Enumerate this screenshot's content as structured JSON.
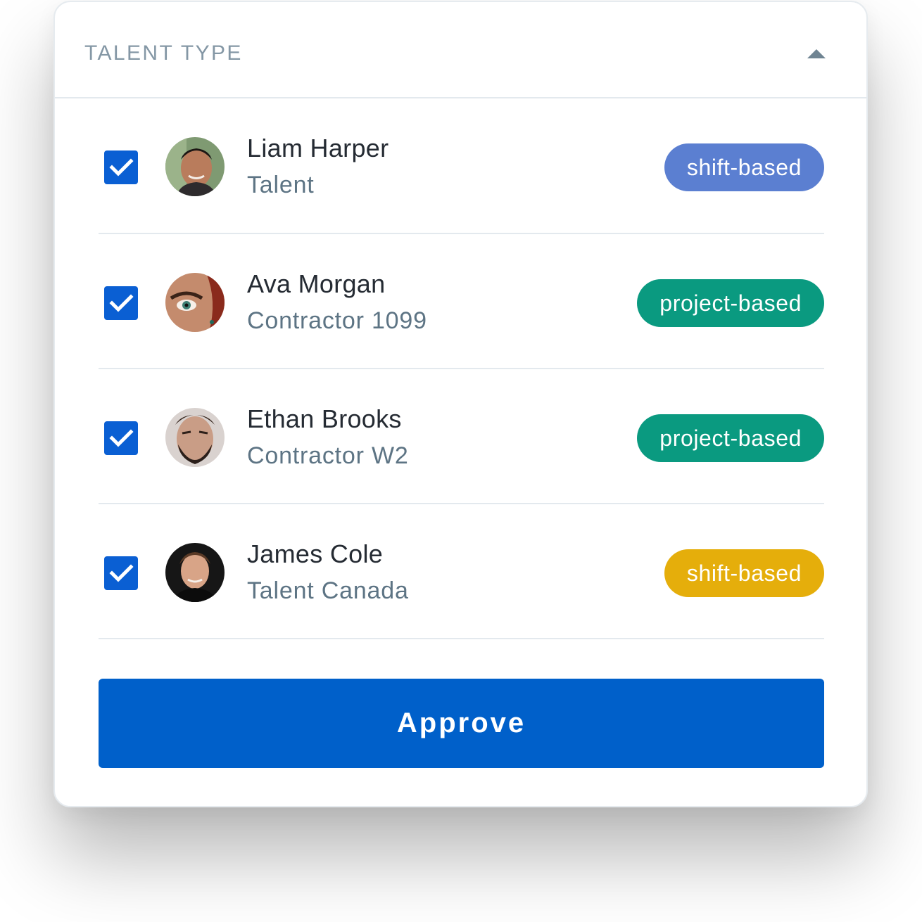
{
  "header": {
    "title": "TALENT TYPE",
    "collapse_icon": "caret-up-icon"
  },
  "colors": {
    "checkbox": "#0a5fd3",
    "approve_button": "#0060ca",
    "badge_shift_blue": "#5b7fd1",
    "badge_project_green": "#0a9a80",
    "badge_shift_yellow": "#e5ae0b"
  },
  "talents": [
    {
      "checked": true,
      "avatar_icon": "avatar-photo",
      "name": "Liam Harper",
      "role": "Talent",
      "badge": "shift-based",
      "badge_color": "#5b7fd1"
    },
    {
      "checked": true,
      "avatar_icon": "avatar-photo",
      "name": "Ava Morgan",
      "role": "Contractor 1099",
      "badge": "project-based",
      "badge_color": "#0a9a80"
    },
    {
      "checked": true,
      "avatar_icon": "avatar-photo",
      "name": "Ethan Brooks",
      "role": "Contractor W2",
      "badge": "project-based",
      "badge_color": "#0a9a80"
    },
    {
      "checked": true,
      "avatar_icon": "avatar-photo",
      "name": "James Cole",
      "role": "Talent Canada",
      "badge": "shift-based",
      "badge_color": "#e5ae0b"
    }
  ],
  "actions": {
    "approve_label": "Approve"
  }
}
